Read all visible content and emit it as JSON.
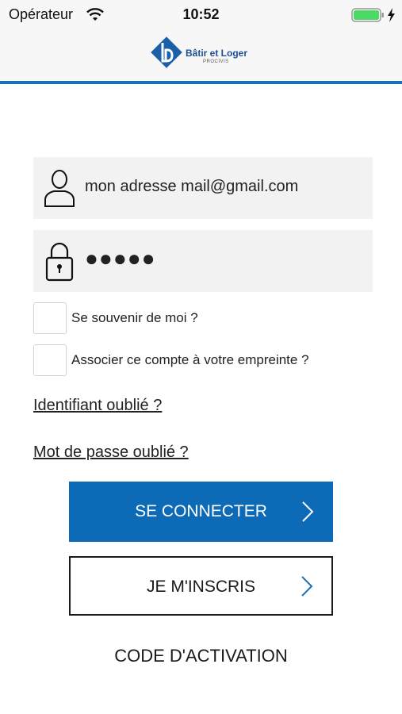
{
  "status_bar": {
    "carrier": "Opérateur",
    "time": "10:52",
    "battery_color": "#4cd964"
  },
  "header": {
    "logo_name": "Bâtir et Loger",
    "logo_sub": "PROCIVIS",
    "accent_color": "#1b6fb6"
  },
  "login": {
    "email_value": "mon adresse mail@gmail.com",
    "email_icon": "user-icon",
    "password_value": "●●●●●",
    "password_icon": "lock-icon"
  },
  "options": {
    "remember_label": "Se souvenir de moi ?",
    "fingerprint_label": "Associer ce compte à votre empreinte ?"
  },
  "links": {
    "forgot_id": "Identifiant oublié ?",
    "forgot_password": "Mot de passe oublié ?"
  },
  "buttons": {
    "connect_label": "SE CONNECTER",
    "connect_color": "#0c6ab7",
    "signup_label": "JE M'INSCRIS",
    "activation_label": "CODE D'ACTIVATION"
  }
}
